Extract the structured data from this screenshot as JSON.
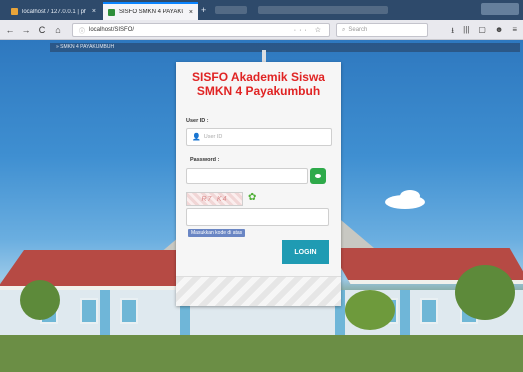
{
  "browser": {
    "tabs": [
      {
        "label": "localhost / 127.0.0.1 | phpMyAdmin",
        "active": false,
        "favicon_color": "#e8a43a"
      },
      {
        "label": "SISFO SMKN 4 PAYAKUMBUH",
        "active": true,
        "favicon_color": "#2f8f3a"
      }
    ],
    "new_tab_label": "+",
    "close_label": "×",
    "nav": {
      "back": "←",
      "forward": "→",
      "reload": "C",
      "home": "⌂"
    },
    "url": "localhost/SISFO/",
    "url_actions": "··· ☆",
    "search_placeholder": "Search",
    "toolbar_icons": [
      "⭳",
      "|||",
      "▢",
      "☻",
      "≡"
    ]
  },
  "page": {
    "breadcrumb": "» SMKN 4 PAYAKUMBUH"
  },
  "login": {
    "title_line1": "SISFO Akademik Siswa",
    "title_line2": "SMKN 4 Payakumbuh",
    "userid_label": "User ID :",
    "userid_placeholder": "User ID",
    "password_label": "Password :",
    "captcha_text": "R7 K4",
    "hint": "Masukkan kode di atas",
    "login_button": "LOGIN"
  },
  "colors": {
    "title": "#e02424",
    "login_button": "#1f9bb3",
    "eye_button": "#2eaa4a"
  }
}
